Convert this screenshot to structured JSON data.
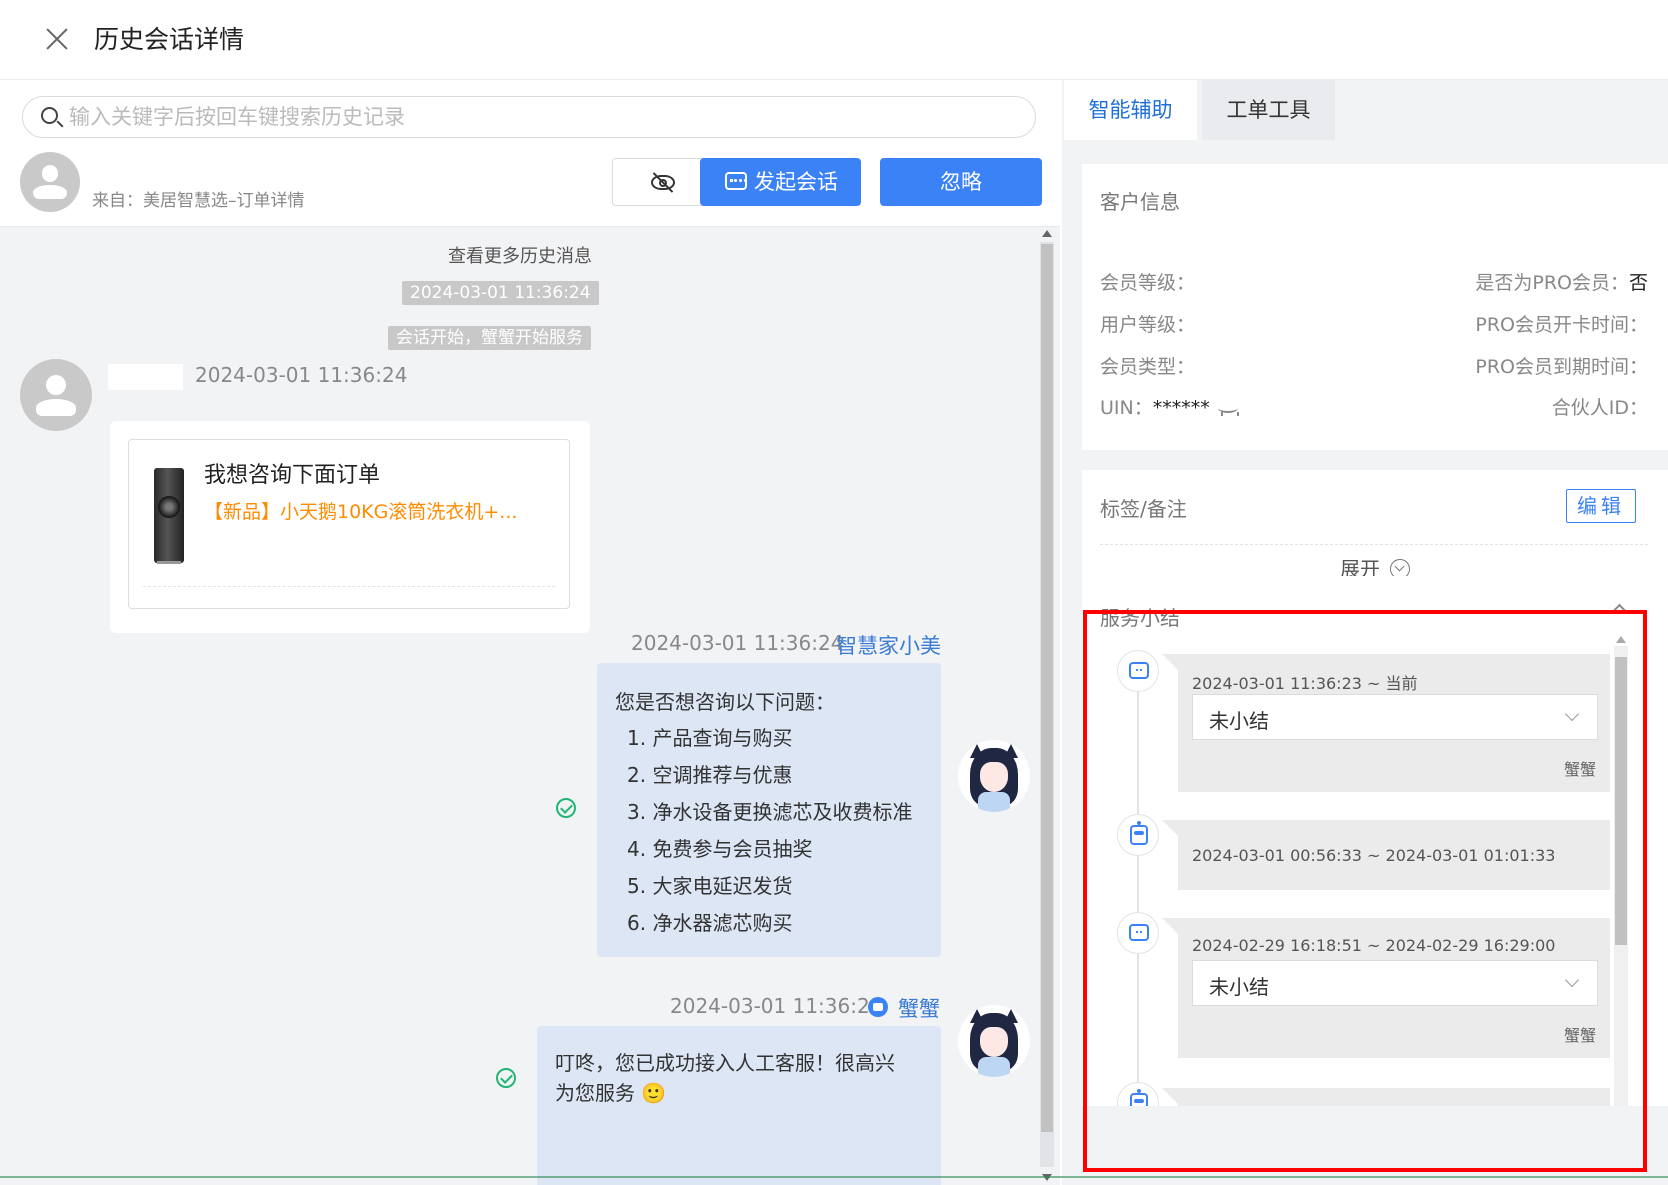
{
  "header": {
    "title": "历史会话详情"
  },
  "search": {
    "placeholder": "输入关键字后按回车键搜索历史记录"
  },
  "customer": {
    "source": "来自：美居智慧选–订单详情"
  },
  "toolbar": {
    "start_session_label": "发起会话",
    "ignore_label": "忽略"
  },
  "chat": {
    "more_history": "查看更多历史消息",
    "system_time": "2024-03-01 11:36:24",
    "system_notice": "会话开始，蟹蟹开始服务",
    "customer_msg_time": "2024-03-01 11:36:24",
    "order_card": {
      "title": "我想咨询下面订单",
      "product": "【新品】小天鹅10KG滚筒洗衣机+..."
    },
    "bot_msg": {
      "time": "2024-03-01 11:36:24",
      "sender": "智慧家小美",
      "intro": "您是否想咨询以下问题：",
      "options": [
        "1. 产品查询与购买",
        "2. 空调推荐与优惠",
        "3. 净水设备更换滤芯及收费标准",
        "4. 免费参与会员抽奖",
        "5. 大家电延迟发货",
        "6. 净水器滤芯购买"
      ]
    },
    "agent_msg": {
      "time": "2024-03-01 11:36:24",
      "sender": "蟹蟹",
      "text_line1": "叮咚，您已成功接入人工客服！很高兴",
      "text_line2": "为您服务 🙂"
    }
  },
  "right_panel": {
    "tabs": [
      "智能辅助",
      "工单工具"
    ],
    "customer_info": {
      "title": "客户信息",
      "member_level": "会员等级：",
      "is_pro_label": "是否为PRO会员：",
      "is_pro_value": "否",
      "user_level": "用户等级：",
      "pro_open_time": "PRO会员开卡时间：",
      "member_type": "会员类型：",
      "pro_expire_time": "PRO会员到期时间：",
      "uin_label": "UIN：",
      "uin_value": "******",
      "partner_id": "合伙人ID："
    },
    "tags": {
      "title": "标签/备注",
      "edit_label": "编辑",
      "expand_label": "展开"
    },
    "summary": {
      "title": "服务小结",
      "items": [
        {
          "time": "2024-03-01 11:36:23 ~ 当前",
          "status": "未小结",
          "agent": "蟹蟹"
        },
        {
          "time": "2024-03-01 00:56:33 ~ 2024-03-01 01:01:33"
        },
        {
          "time": "2024-02-29 16:18:51 ~ 2024-02-29 16:29:00",
          "status": "未小结",
          "agent": "蟹蟹"
        }
      ]
    }
  },
  "colors": {
    "primary": "#3b82f6",
    "highlight_box": "#ff0000",
    "order_product": "#ff8c00",
    "read_check": "#22b573"
  }
}
